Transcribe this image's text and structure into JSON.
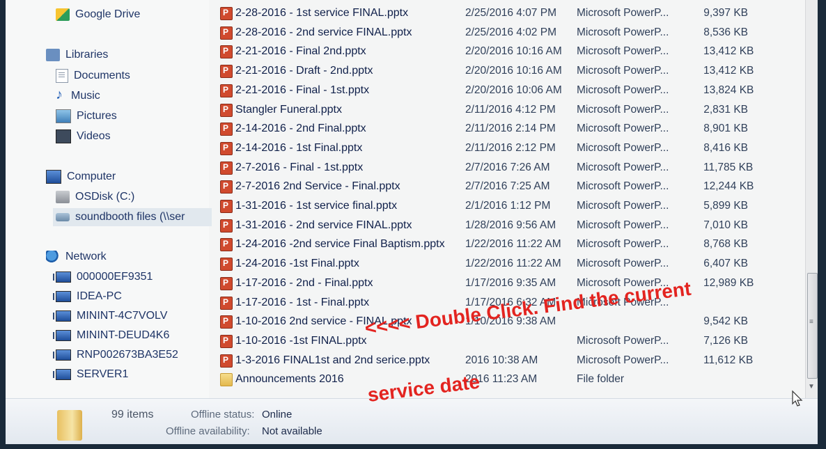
{
  "nav": {
    "items": [
      {
        "label": "Google Drive",
        "icon": "google-drive-icon"
      },
      {
        "label": "Libraries",
        "icon": "libraries-icon"
      },
      {
        "label": "Documents",
        "icon": "documents-icon"
      },
      {
        "label": "Music",
        "icon": "music-icon"
      },
      {
        "label": "Pictures",
        "icon": "pictures-icon"
      },
      {
        "label": "Videos",
        "icon": "videos-icon"
      },
      {
        "label": "Computer",
        "icon": "computer-icon"
      },
      {
        "label": "OSDisk (C:)",
        "icon": "disk-icon"
      },
      {
        "label": "soundbooth files (\\\\ser",
        "icon": "network-drive-icon"
      },
      {
        "label": "Network",
        "icon": "network-icon"
      },
      {
        "label": "000000EF9351",
        "icon": "computer-icon"
      },
      {
        "label": "IDEA-PC",
        "icon": "computer-icon"
      },
      {
        "label": "MININT-4C7VOLV",
        "icon": "computer-icon"
      },
      {
        "label": "MININT-DEUD4K6",
        "icon": "computer-icon"
      },
      {
        "label": "RNP002673BA3E52",
        "icon": "computer-icon"
      },
      {
        "label": "SERVER1",
        "icon": "computer-icon"
      }
    ]
  },
  "files": [
    {
      "name": "2-28-2016 - 1st service FINAL.pptx",
      "date": "2/25/2016 4:07 PM",
      "type": "Microsoft PowerP...",
      "size": "9,397 KB"
    },
    {
      "name": "2-28-2016 - 2nd service FINAL.pptx",
      "date": "2/25/2016 4:02 PM",
      "type": "Microsoft PowerP...",
      "size": "8,536 KB"
    },
    {
      "name": "2-21-2016 - Final 2nd.pptx",
      "date": "2/20/2016 10:16 AM",
      "type": "Microsoft PowerP...",
      "size": "13,412 KB"
    },
    {
      "name": "2-21-2016 - Draft - 2nd.pptx",
      "date": "2/20/2016 10:16 AM",
      "type": "Microsoft PowerP...",
      "size": "13,412 KB"
    },
    {
      "name": "2-21-2016 - Final - 1st.pptx",
      "date": "2/20/2016 10:06 AM",
      "type": "Microsoft PowerP...",
      "size": "13,824 KB"
    },
    {
      "name": "Stangler Funeral.pptx",
      "date": "2/11/2016 4:12 PM",
      "type": "Microsoft PowerP...",
      "size": "2,831 KB"
    },
    {
      "name": "2-14-2016 - 2nd Final.pptx",
      "date": "2/11/2016 2:14 PM",
      "type": "Microsoft PowerP...",
      "size": "8,901 KB"
    },
    {
      "name": "2-14-2016 - 1st Final.pptx",
      "date": "2/11/2016 2:12 PM",
      "type": "Microsoft PowerP...",
      "size": "8,416 KB"
    },
    {
      "name": "2-7-2016 - Final - 1st.pptx",
      "date": "2/7/2016 7:26 AM",
      "type": "Microsoft PowerP...",
      "size": "11,785 KB"
    },
    {
      "name": "2-7-2016  2nd Service - Final.pptx",
      "date": "2/7/2016 7:25 AM",
      "type": "Microsoft PowerP...",
      "size": "12,244 KB"
    },
    {
      "name": "1-31-2016 - 1st service  final.pptx",
      "date": "2/1/2016 1:12 PM",
      "type": "Microsoft PowerP...",
      "size": "5,899 KB"
    },
    {
      "name": "1-31-2016 - 2nd service FINAL.pptx",
      "date": "1/28/2016 9:56 AM",
      "type": "Microsoft PowerP...",
      "size": "7,010 KB"
    },
    {
      "name": "1-24-2016 -2nd service Final Baptism.pptx",
      "date": "1/22/2016 11:22 AM",
      "type": "Microsoft PowerP...",
      "size": "8,768 KB"
    },
    {
      "name": "1-24-2016 -1st Final.pptx",
      "date": "1/22/2016 11:22 AM",
      "type": "Microsoft PowerP...",
      "size": "6,407 KB"
    },
    {
      "name": "1-17-2016 - 2nd - Final.pptx",
      "date": "1/17/2016 9:35 AM",
      "type": "Microsoft PowerP...",
      "size": "12,989 KB"
    },
    {
      "name": "1-17-2016 - 1st - Final.pptx",
      "date": "1/17/2016 6:32 AM",
      "type": "Microsoft PowerP...",
      "size": ""
    },
    {
      "name": "1-10-2016 2nd service - FINAL.pptx",
      "date": "1/10/2016 9:38 AM",
      "type": "",
      "size": "9,542 KB"
    },
    {
      "name": "1-10-2016 -1st FINAL.pptx",
      "date": "",
      "type": "Microsoft PowerP...",
      "size": "7,126 KB"
    },
    {
      "name": "1-3-2016 FINAL1st and 2nd serice.pptx",
      "date": "2016 10:38 AM",
      "type": "Microsoft PowerP...",
      "size": "11,612 KB"
    },
    {
      "name": "Announcements 2016",
      "date": "2016 11:23 AM",
      "type": "File folder",
      "size": "",
      "folder": true
    }
  ],
  "details": {
    "item_count": "99 items",
    "offline_status_label": "Offline status:",
    "offline_status_value": "Online",
    "offline_availability_label": "Offline availability:",
    "offline_availability_value": "Not available"
  },
  "annotation": {
    "line1": "<<<< Double Click.  Find the current",
    "line2": "service date",
    "color": "#e32420"
  },
  "colors": {
    "accent": "#1e3466",
    "annotation": "#e32420"
  }
}
